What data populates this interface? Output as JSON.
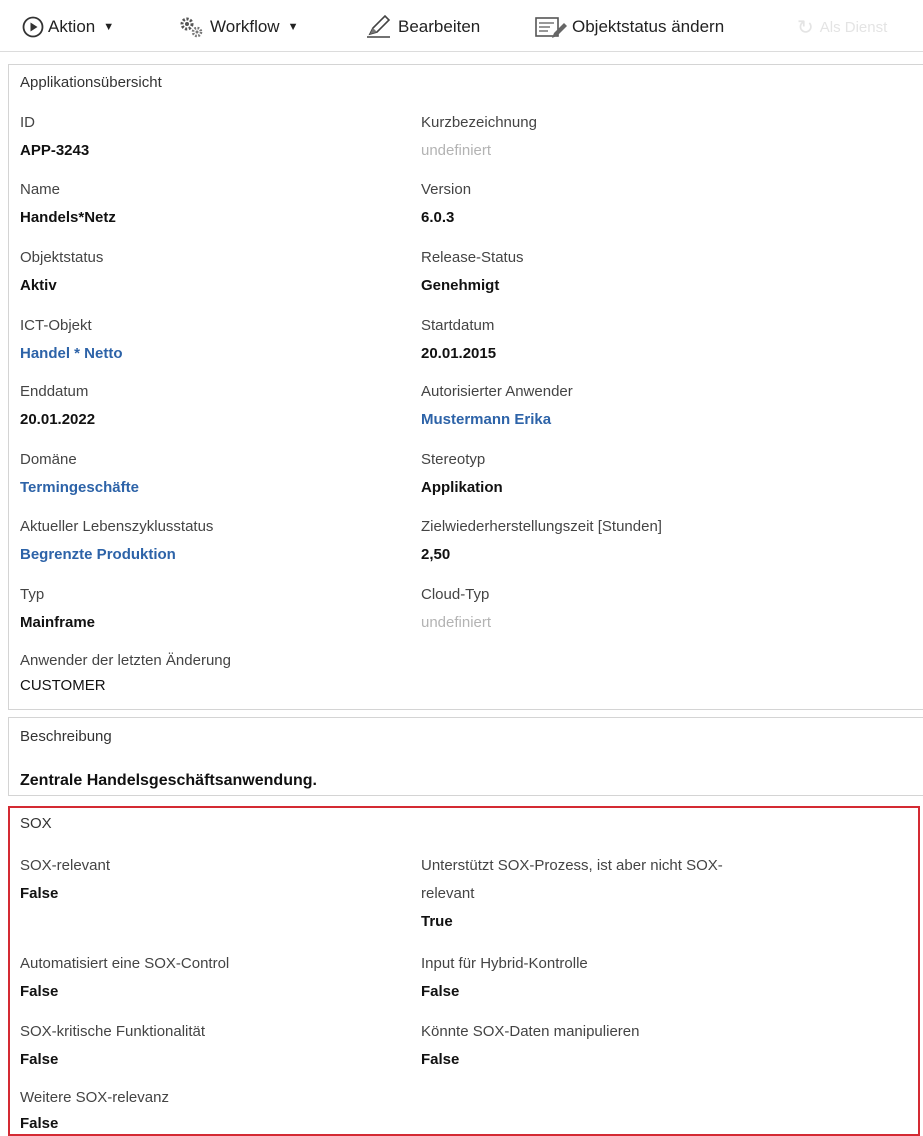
{
  "toolbar": {
    "aktion_label": "Aktion",
    "workflow_label": "Workflow",
    "edit_label": "Bearbeiten",
    "status_label": "Objektstatus ändern",
    "ghost_label": "Als Dienst"
  },
  "overview": {
    "title": "Applikationsübersicht",
    "fields": {
      "id": {
        "label": "ID",
        "value": "APP-3243"
      },
      "short_name": {
        "label": "Kurzbezeichnung",
        "value": "undefiniert"
      },
      "name": {
        "label": "Name",
        "value": "Handels*Netz"
      },
      "version": {
        "label": "Version",
        "value": "6.0.3"
      },
      "object_status": {
        "label": "Objektstatus",
        "value": "Aktiv"
      },
      "release_status": {
        "label": "Release-Status",
        "value": "Genehmigt"
      },
      "ict_object": {
        "label": "ICT-Objekt",
        "value": "Handel * Netto"
      },
      "start_date": {
        "label": "Startdatum",
        "value": "20.01.2015"
      },
      "end_date": {
        "label": "Enddatum",
        "value": "20.01.2022"
      },
      "authorized_user": {
        "label": "Autorisierter Anwender",
        "value": "Mustermann Erika"
      },
      "domain": {
        "label": "Domäne",
        "value": "Termingeschäfte"
      },
      "stereotype": {
        "label": "Stereotyp",
        "value": "Applikation"
      },
      "lifecycle": {
        "label": "Aktueller Lebenszyklusstatus",
        "value": "Begrenzte Produktion"
      },
      "rto": {
        "label": "Zielwiederherstellungszeit [Stunden]",
        "value": "2,50"
      },
      "type": {
        "label": "Typ",
        "value": "Mainframe"
      },
      "cloud_type": {
        "label": "Cloud-Typ",
        "value": "undefiniert"
      },
      "last_changed_by": {
        "label": "Anwender der letzten Änderung",
        "value": "CUSTOMER"
      }
    }
  },
  "description": {
    "title": "Beschreibung",
    "text": "Zentrale Handelsgeschäftsanwendung."
  },
  "sox": {
    "title": "SOX",
    "fields": {
      "sox_relevant": {
        "label": "SOX-relevant",
        "value": "False"
      },
      "supports_sox": {
        "label_line1": "Unterstützt SOX-Prozess, ist aber nicht SOX-",
        "label_line2": "relevant",
        "value": "True"
      },
      "automates_control": {
        "label": "Automatisiert eine SOX-Control",
        "value": "False"
      },
      "hybrid_input": {
        "label": "Input für Hybrid-Kontrolle",
        "value": "False"
      },
      "critical_func": {
        "label": "SOX-kritische Funktionalität",
        "value": "False"
      },
      "manipulate_data": {
        "label": "Könnte SOX-Daten manipulieren",
        "value": "False"
      },
      "further_relevance": {
        "label": "Weitere SOX-relevanz",
        "value": "False"
      }
    }
  },
  "colors": {
    "link": "#2d63a8",
    "undefined": "#b3b3b3",
    "sox_border": "#d42a33"
  }
}
